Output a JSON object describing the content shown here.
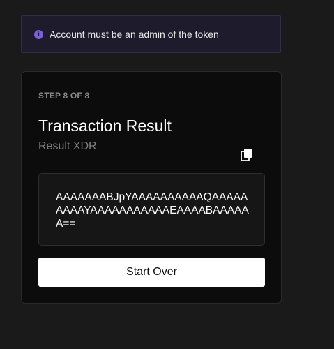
{
  "banner": {
    "icon": "info-icon",
    "icon_glyph": "i",
    "text": "Account must be an admin of the token",
    "accent_color": "#7c5fe0"
  },
  "card": {
    "step_label": "STEP 8 OF 8",
    "title": "Transaction Result",
    "subtitle": "Result XDR",
    "copy_icon": "copy-icon",
    "result_xdr": "AAAAAAABJpYAAAAAAAAAAQAAAAAAAAAYAAAAAAAAAAAEAAAABAAAAAA==",
    "start_over_label": "Start Over"
  }
}
